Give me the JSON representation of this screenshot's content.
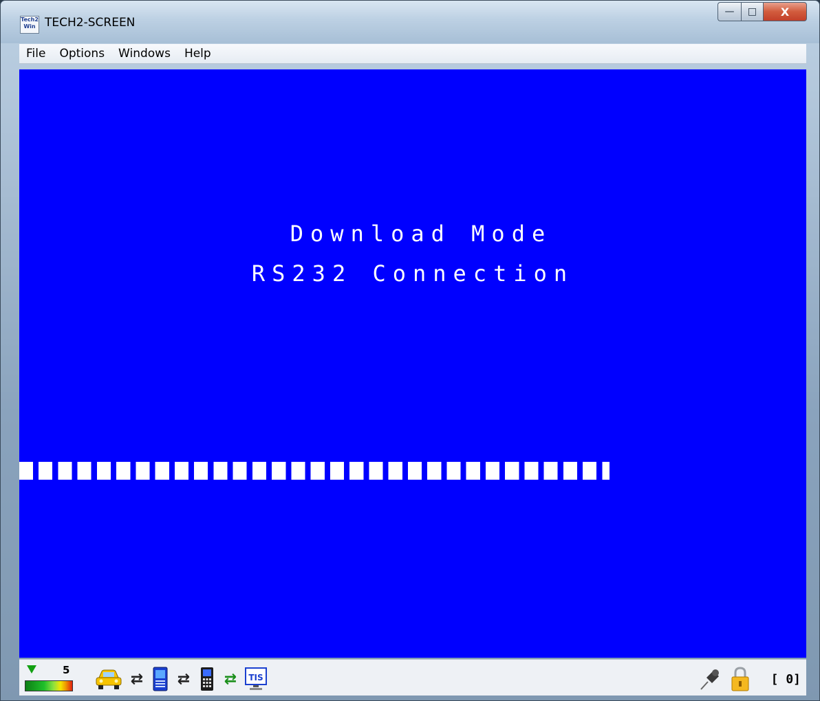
{
  "window": {
    "title": "TECH2-SCREEN",
    "icon_text": "Tech2 Win"
  },
  "controls": {
    "minimize": "—",
    "maximize": "□",
    "close": "X"
  },
  "menu": [
    "File",
    "Options",
    "Windows",
    "Help"
  ],
  "screen": {
    "line1": "Download Mode",
    "line2": "RS232 Connection",
    "progress_fraction": 0.75
  },
  "statusbar": {
    "signal_value": "5",
    "count": "[ 0]",
    "tis_label": "TIS",
    "icons": [
      "signal-meter-icon",
      "car-icon",
      "swap-arrows-icon",
      "tech2-device-icon",
      "swap-arrows-icon",
      "handset-icon",
      "swap-arrows-icon",
      "tis-icon",
      "pin-icon",
      "lock-icon"
    ]
  }
}
